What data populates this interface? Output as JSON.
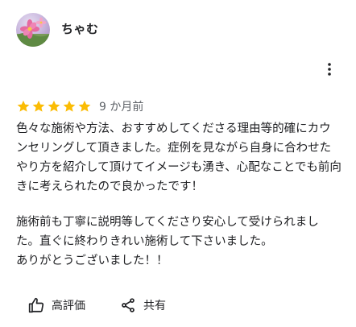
{
  "review": {
    "author": "ちゃむ",
    "rating": 5,
    "rating_max": 5,
    "star_color": "#fbbc04",
    "date": "9 か月前",
    "paragraph1": "色々な施術や方法、おすすめしてくださる理由等的確にカウンセリングして頂きました。症例を見ながら自身に合わせたやり方を紹介して頂けてイメージも湧き、心配なことでも前向きに考えられたので良かったです！",
    "paragraph2": "施術前も丁寧に説明等してくださり安心して受けられました。直ぐに終わりきれい施術して下さいました。",
    "paragraph3": "ありがとうございました！！"
  },
  "actions": {
    "like_label": "高評価",
    "share_label": "共有"
  },
  "icons": {
    "more": "more-vert-icon",
    "like": "thumb-up-icon",
    "share": "share-icon",
    "star": "star-icon"
  }
}
